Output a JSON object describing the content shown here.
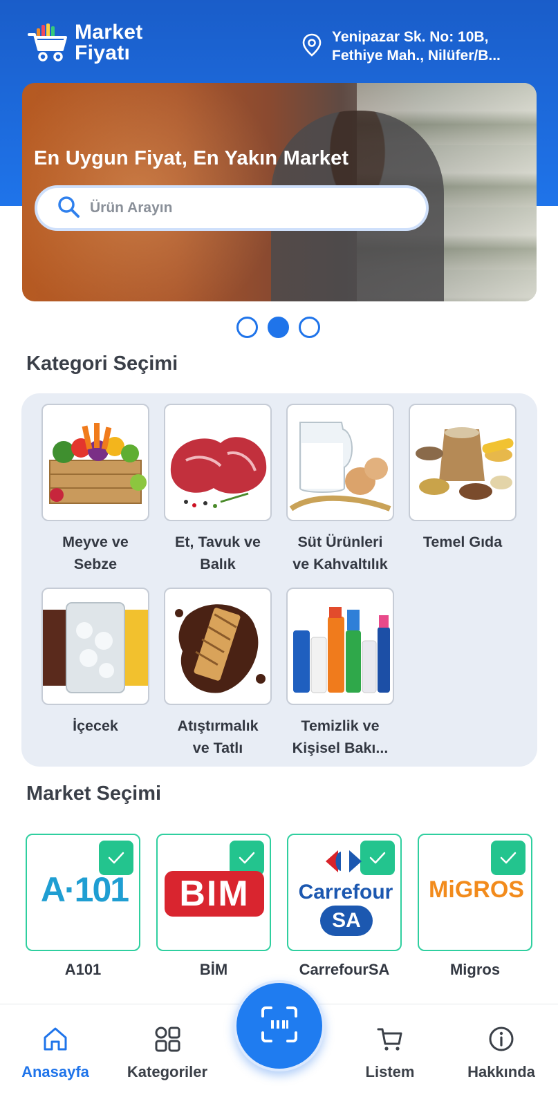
{
  "header": {
    "logo_line1": "Market",
    "logo_line2": "Fiyatı",
    "location_line1": "Yenipazar Sk. No: 10B,",
    "location_line2": "Fethiye Mah., Nilüfer/B..."
  },
  "banner": {
    "title": "En Uygun Fiyat, En Yakın Market",
    "search_placeholder": "Ürün Arayın",
    "carousel_dots": 3,
    "carousel_active_index": 1
  },
  "categories": {
    "title": "Kategori Seçimi",
    "items": [
      {
        "line1": "Meyve ve",
        "line2": "Sebze",
        "image": "fruit-vegetable-crate"
      },
      {
        "line1": "Et, Tavuk ve",
        "line2": "Balık",
        "image": "raw-meat"
      },
      {
        "line1": "Süt Ürünleri",
        "line2": "ve Kahvaltılık",
        "image": "milk-eggs"
      },
      {
        "line1": "Temel Gıda",
        "line2": "",
        "image": "grains-sack"
      },
      {
        "line1": "İçecek",
        "line2": "",
        "image": "drink-glasses"
      },
      {
        "line1": "Atıştırmalık",
        "line2": "ve Tatlı",
        "image": "wafer-chocolate"
      },
      {
        "line1": "Temizlik ve",
        "line2": "Kişisel Bakı...",
        "image": "cleaning-bottles"
      }
    ]
  },
  "markets": {
    "title": "Market Seçimi",
    "items": [
      {
        "name": "A101",
        "logo_text": "A·101",
        "selected": true
      },
      {
        "name": "BİM",
        "logo_text": "BIM",
        "selected": true
      },
      {
        "name": "CarrefourSA",
        "logo_text": "Carrefour",
        "logo_sub": "SA",
        "selected": true
      },
      {
        "name": "Migros",
        "logo_text": "MiGROS",
        "selected": true
      }
    ]
  },
  "tabbar": {
    "home": "Anasayfa",
    "categories": "Kategoriler",
    "list": "Listem",
    "about": "Hakkında",
    "active": "home"
  },
  "colors": {
    "primary": "#1f74ea",
    "check_green": "#23c48e",
    "card_border": "#2fcf9f",
    "panel_bg": "#e8edf5"
  }
}
